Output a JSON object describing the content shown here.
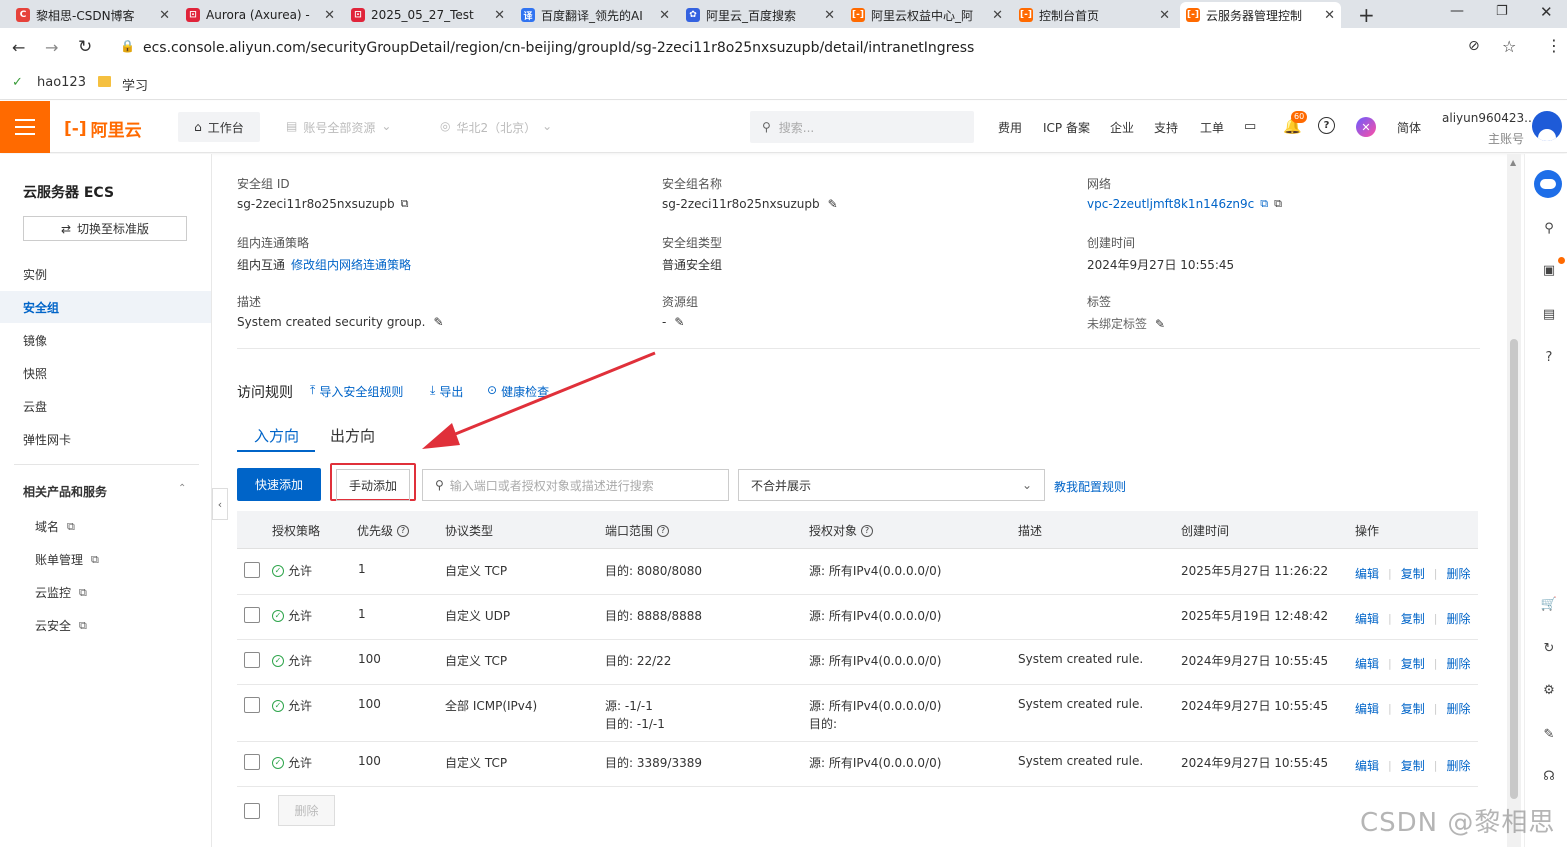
{
  "browser": {
    "tabs": [
      {
        "label": "黎相思-CSDN博客",
        "fav": "C",
        "color": "#e6423a"
      },
      {
        "label": "Aurora (Axurea) -",
        "fav": "⊡",
        "color": "#e0243a"
      },
      {
        "label": "2025_05_27_Test",
        "fav": "⊡",
        "color": "#e0243a"
      },
      {
        "label": "百度翻译_领先的AI",
        "fav": "译",
        "color": "#3073f1"
      },
      {
        "label": "阿里云_百度搜索",
        "fav": "✿",
        "color": "#3462e0"
      },
      {
        "label": "阿里云权益中心_阿",
        "fav": "[-]",
        "color": "#ff6a00"
      },
      {
        "label": "控制台首页",
        "fav": "[-]",
        "color": "#ff6a00"
      },
      {
        "label": "云服务器管理控制",
        "fav": "[-]",
        "color": "#ff6a00"
      }
    ],
    "url": "ecs.console.aliyun.com/securityGroupDetail/region/cn-beijing/groupId/sg-2zeci11r8o25nxsuzupb/detail/intranetIngress",
    "bookmarks": [
      {
        "label": "hao123"
      },
      {
        "label": "学习"
      }
    ]
  },
  "topnav": {
    "logo": "阿里云",
    "workbench": "工作台",
    "resources": "账号全部资源",
    "region": "华北2（北京）",
    "search_placeholder": "搜索...",
    "links": [
      "费用",
      "ICP 备案",
      "企业",
      "支持",
      "工单"
    ],
    "badge": "60",
    "lang": "简体",
    "user": "aliyun960423...",
    "role": "主账号"
  },
  "sidebar": {
    "title": "云服务器 ECS",
    "switch": "切换至标准版",
    "items": [
      "实例",
      "安全组",
      "镜像",
      "快照",
      "云盘",
      "弹性网卡"
    ],
    "section": "相关产品和服务",
    "links": [
      "域名",
      "账单管理",
      "云监控",
      "云安全"
    ]
  },
  "detail": {
    "fields": [
      {
        "label": "安全组 ID",
        "value": "sg-2zeci11r8o25nxsuzupb"
      },
      {
        "label": "安全组名称",
        "value": "sg-2zeci11r8o25nxsuzupb"
      },
      {
        "label": "网络",
        "value": "vpc-2zeutljmft8k1n146zn9c"
      },
      {
        "label": "组内连通策略",
        "value": "组内互通",
        "link": "修改组内网络连通策略"
      },
      {
        "label": "安全组类型",
        "value": "普通安全组"
      },
      {
        "label": "创建时间",
        "value": "2024年9月27日 10:55:45"
      },
      {
        "label": "描述",
        "value": "System created security group."
      },
      {
        "label": "资源组",
        "value": "-"
      },
      {
        "label": "标签",
        "value": "未绑定标签"
      }
    ]
  },
  "rules": {
    "title": "访问规则",
    "actions": [
      "导入安全组规则",
      "导出",
      "健康检查"
    ],
    "tabs": [
      "入方向",
      "出方向"
    ],
    "quick_add": "快速添加",
    "manual_add": "手动添加",
    "search_placeholder": "输入端口或者授权对象或描述进行搜索",
    "merge_select": "不合并展示",
    "help_link": "教我配置规则",
    "headers": [
      "授权策略",
      "优先级",
      "协议类型",
      "端口范围",
      "授权对象",
      "描述",
      "创建时间",
      "操作"
    ],
    "rows": [
      {
        "policy": "允许",
        "priority": "1",
        "protocol": "自定义 TCP",
        "port": "目的: 8080/8080",
        "port2": "",
        "obj": "源: 所有IPv4(0.0.0.0/0)",
        "obj2": "",
        "desc": "",
        "time": "2025年5月27日 11:26:22"
      },
      {
        "policy": "允许",
        "priority": "1",
        "protocol": "自定义 UDP",
        "port": "目的: 8888/8888",
        "port2": "",
        "obj": "源: 所有IPv4(0.0.0.0/0)",
        "obj2": "",
        "desc": "",
        "time": "2025年5月19日 12:48:42"
      },
      {
        "policy": "允许",
        "priority": "100",
        "protocol": "自定义 TCP",
        "port": "目的: 22/22",
        "port2": "",
        "obj": "源: 所有IPv4(0.0.0.0/0)",
        "obj2": "",
        "desc": "System created rule.",
        "time": "2024年9月27日 10:55:45"
      },
      {
        "policy": "允许",
        "priority": "100",
        "protocol": "全部 ICMP(IPv4)",
        "port": "源: -1/-1",
        "port2": "目的: -1/-1",
        "obj": "源: 所有IPv4(0.0.0.0/0)",
        "obj2": "目的:",
        "desc": "System created rule.",
        "time": "2024年9月27日 10:55:45"
      },
      {
        "policy": "允许",
        "priority": "100",
        "protocol": "自定义 TCP",
        "port": "目的: 3389/3389",
        "port2": "",
        "obj": "源: 所有IPv4(0.0.0.0/0)",
        "obj2": "",
        "desc": "System created rule.",
        "time": "2024年9月27日 10:55:45"
      }
    ],
    "ops": [
      "编辑",
      "复制",
      "删除"
    ],
    "delete_btn": "删除"
  },
  "watermark": "CSDN @黎相思",
  "colors": {
    "brand": "#ff6a00",
    "primary": "#0064c8",
    "highlight": "#e0303a"
  }
}
